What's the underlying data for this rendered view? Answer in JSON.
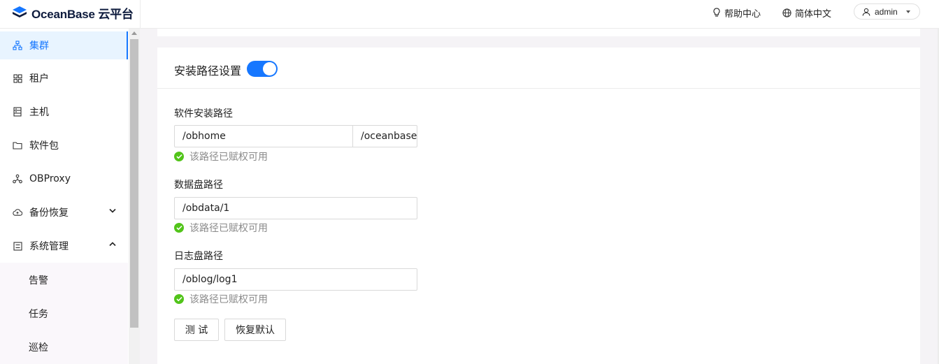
{
  "header": {
    "logo_text": "OceanBase 云平台",
    "help_label": "帮助中心",
    "language_label": "简体中文",
    "user_label": "admin"
  },
  "sidebar": {
    "items": [
      {
        "label": "集群",
        "icon": "cluster-icon",
        "active": true
      },
      {
        "label": "租户",
        "icon": "tenant-icon"
      },
      {
        "label": "主机",
        "icon": "host-icon"
      },
      {
        "label": "软件包",
        "icon": "folder-icon"
      },
      {
        "label": "OBProxy",
        "icon": "proxy-icon"
      },
      {
        "label": "备份恢复",
        "icon": "cloud-backup-icon",
        "expanded": false
      },
      {
        "label": "系统管理",
        "icon": "system-icon",
        "expanded": true
      }
    ],
    "subitems": [
      {
        "label": "告警"
      },
      {
        "label": "任务"
      },
      {
        "label": "巡检"
      }
    ]
  },
  "install_path": {
    "title": "安装路径设置",
    "toggle_on": true,
    "software": {
      "label": "软件安装路径",
      "value": "/obhome",
      "suffix": "/oceanbase",
      "hint": "该路径已赋权可用"
    },
    "data_disk": {
      "label": "数据盘路径",
      "value": "/obdata/1",
      "hint": "该路径已赋权可用"
    },
    "log_disk": {
      "label": "日志盘路径",
      "value": "/oblog/log1",
      "hint": "该路径已赋权可用"
    },
    "test_button": "测 试",
    "reset_button": "恢复默认"
  },
  "colors": {
    "primary": "#1677ff",
    "success": "#52c41a",
    "active_bg": "#e8f4ff"
  }
}
